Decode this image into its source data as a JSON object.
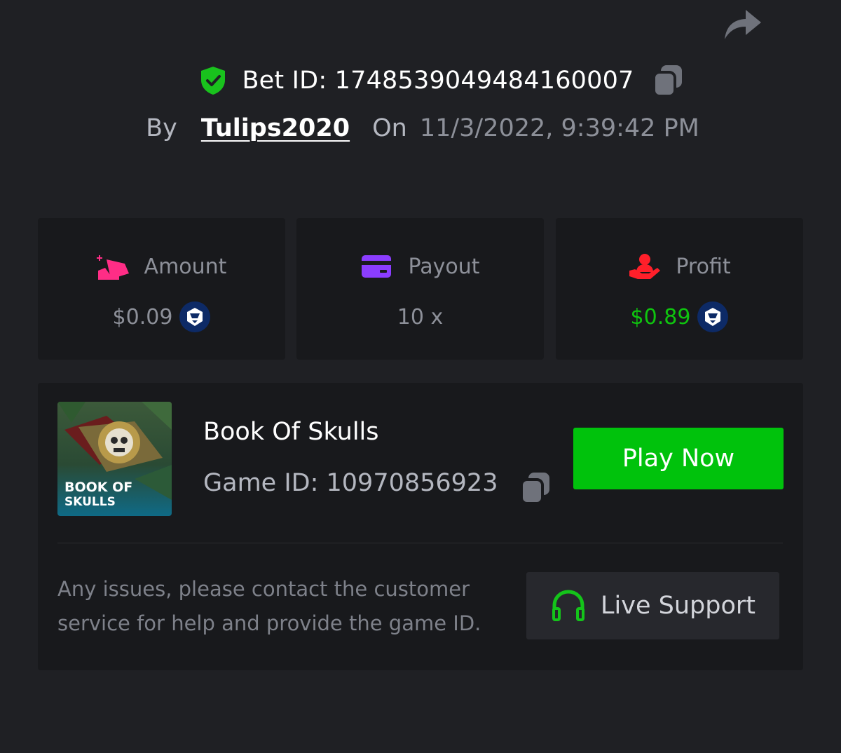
{
  "header": {
    "share_icon": "share-arrow-icon",
    "bet_id": "Bet ID: 1748539049484160007",
    "by_label": "By",
    "username": "Tulips2020",
    "on_label": "On",
    "datetime": "11/3/2022, 9:39:42 PM"
  },
  "stats": [
    {
      "label": "Amount",
      "value": "$0.09",
      "icon": "bet-amount-icon",
      "coin": "crypto-coin-icon",
      "color": "#ff2d86"
    },
    {
      "label": "Payout",
      "value": "10 x",
      "icon": "card-icon",
      "color": "#8b3dff"
    },
    {
      "label": "Profit",
      "value": "$0.89",
      "icon": "profit-hand-icon",
      "coin": "crypto-coin-icon",
      "color": "#ff1f2a",
      "value_color": "#0fc40f"
    }
  ],
  "game": {
    "title": "Book Of Skulls",
    "game_id": "Game ID: 10970856923",
    "thumb_text_line1": "BOOK OF",
    "thumb_text_line2": "SKULLS",
    "play_label": "Play Now"
  },
  "support": {
    "help_text": "Any issues, please contact the customer service for help and provide the game ID.",
    "button_label": "Live Support"
  },
  "colors": {
    "background": "#1f2024",
    "card": "#18191c",
    "accent_green": "#00c20c",
    "shield_green": "#19c21d",
    "muted_text": "#8d9099"
  }
}
